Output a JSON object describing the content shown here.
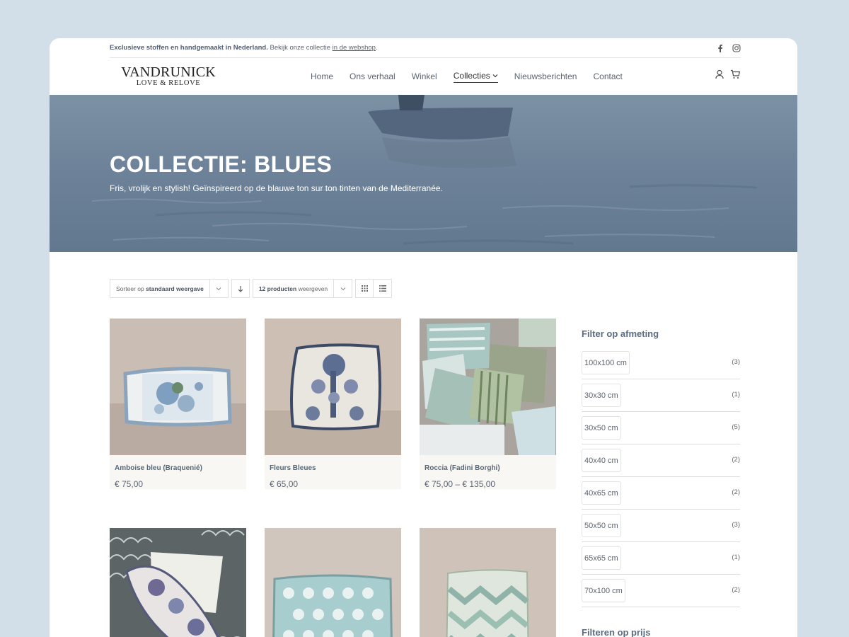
{
  "topbar": {
    "bold_text": "Exclusieve stoffen en handgemaakt in Nederland.",
    "text": "Bekijk onze collectie",
    "link": "in de webshop",
    "suffix": ".",
    "social": [
      "facebook-icon",
      "instagram-icon"
    ]
  },
  "logo": {
    "line1": "VANDRUNICK",
    "line2": "LOVE & RELOVE"
  },
  "nav": {
    "items": [
      "Home",
      "Ons verhaal",
      "Winkel",
      "Collecties",
      "Nieuwsberichten",
      "Contact"
    ],
    "active": "Collecties"
  },
  "hero": {
    "title": "COLLECTIE: BLUES",
    "subtitle": "Fris, vrolijk en stylish! Geïnspireerd op de blauwe ton sur ton tinten van de Mediterranée."
  },
  "toolbar": {
    "sort_prefix": "Sorteer op",
    "sort_value": "standaard weergave",
    "count_value": "12 producten",
    "count_suffix": "weergeven"
  },
  "products": [
    {
      "name": "Amboise bleu (Braquenié)",
      "price": "€ 75,00"
    },
    {
      "name": "Fleurs Bleues",
      "price": "€ 65,00"
    },
    {
      "name": "Roccia (Fadini Borghi)",
      "price": "€ 75,00 – € 135,00"
    }
  ],
  "sidebar": {
    "filter_size_title": "Filter op afmeting",
    "filters": [
      {
        "label": "100x100 cm",
        "count": "(3)"
      },
      {
        "label": "30x30 cm",
        "count": "(1)"
      },
      {
        "label": "30x50 cm",
        "count": "(5)"
      },
      {
        "label": "40x40 cm",
        "count": "(2)"
      },
      {
        "label": "40x65 cm",
        "count": "(2)"
      },
      {
        "label": "50x50 cm",
        "count": "(3)"
      },
      {
        "label": "65x65 cm",
        "count": "(1)"
      },
      {
        "label": "70x100 cm",
        "count": "(2)"
      }
    ],
    "filter_price_title": "Filteren op prijs"
  },
  "colors": {
    "page_bg": "#d3dfe8",
    "accent": "#5a6c82",
    "card_bg": "#f9f7f3"
  }
}
